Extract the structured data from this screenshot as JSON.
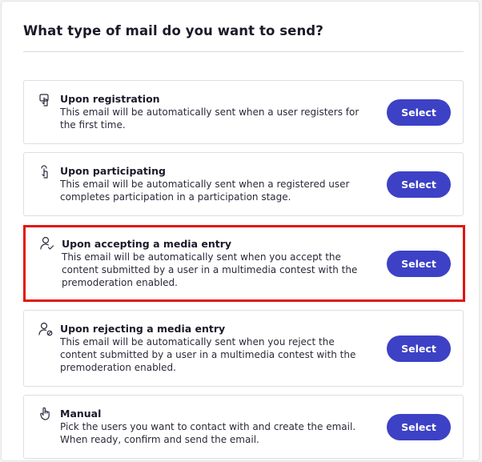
{
  "title": "What type of mail do you want to send?",
  "options": [
    {
      "icon": "register-hand-icon",
      "title": "Upon registration",
      "line1": "This email will be automatically sent when a user registers for",
      "line2": "the first time.",
      "line3": "",
      "button": "Select"
    },
    {
      "icon": "tap-hand-icon",
      "title": "Upon participating",
      "line1": "This email will be automatically sent when a registered user",
      "line2": "completes participation in a participation stage.",
      "line3": "",
      "button": "Select"
    },
    {
      "icon": "user-check-icon",
      "title": "Upon accepting a media entry",
      "line1": "This email will be automatically sent when you accept the",
      "line2": "content submitted by a user in a multimedia contest with the",
      "line3": "premoderation enabled.",
      "button": "Select"
    },
    {
      "icon": "user-reject-icon",
      "title": "Upon rejecting a media entry",
      "line1": "This email will be automatically sent when you reject the",
      "line2": "content submitted by a user in a multimedia contest with the",
      "line3": "premoderation enabled.",
      "button": "Select"
    },
    {
      "icon": "hand-pointer-icon",
      "title": "Manual",
      "line1": "Pick the users you want to contact with and create the email.",
      "line2": "When ready, confirm and send the email.",
      "line3": "",
      "button": "Select"
    }
  ],
  "colors": {
    "button": "#3d41c5",
    "highlight": "#e3150f"
  }
}
